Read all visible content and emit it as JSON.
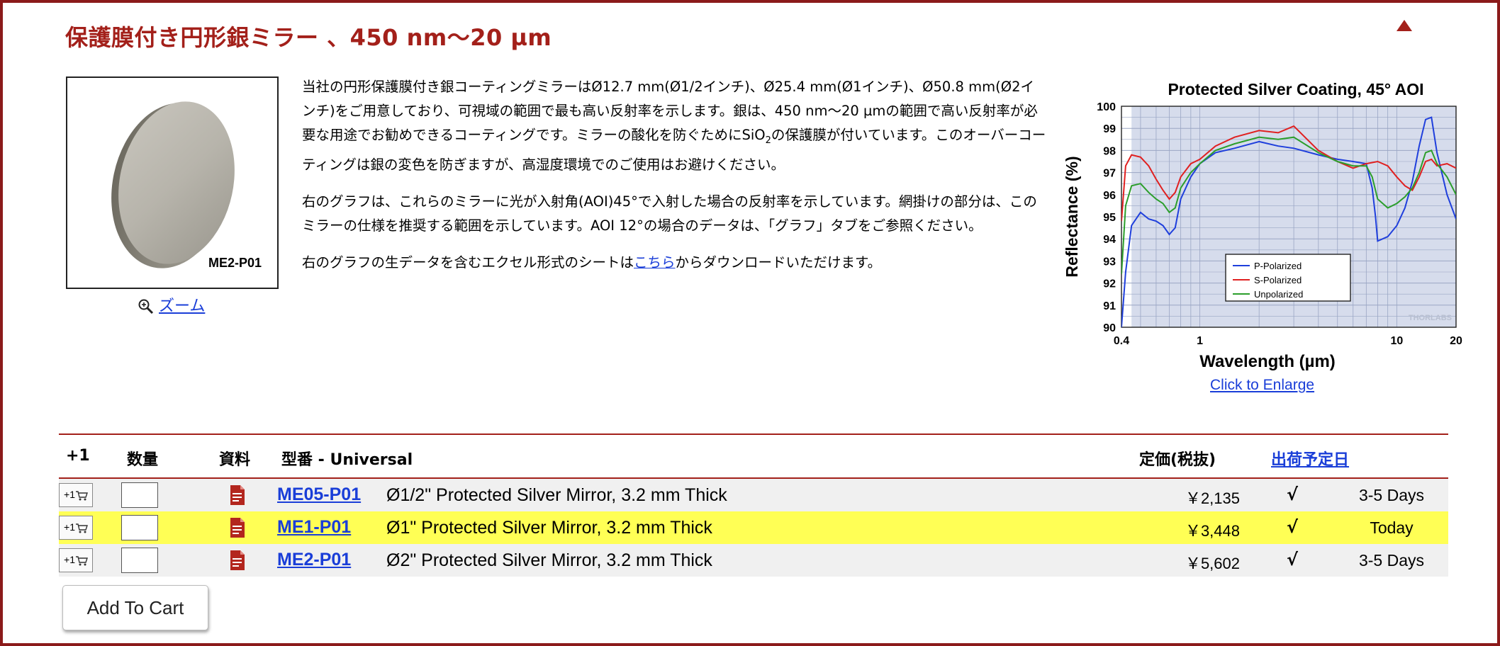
{
  "title": "保護膜付き円形銀ミラー 、450 nm～20 µm",
  "image": {
    "label": "ME2-P01",
    "zoom_label": "ズーム"
  },
  "description": {
    "p1_a": "当社の円形保護膜付き銀コーティングミラーはØ12.7 mm(Ø1/2インチ)、Ø25.4 mm(Ø1インチ)、Ø50.8 mm(Ø2インチ)をご用意しており、可視域の範囲で最も高い反射率を示します。銀は、450 nm～20 µmの範囲で高い反射率が必要な用途でお勧めできるコーティングです。ミラーの酸化を防ぐためにSiO",
    "p1_sub": "2",
    "p1_b": "の保護膜が付いています。このオーバーコーティングは銀の変色を防ぎますが、高湿度環境でのご使用はお避けください。",
    "p2": "右のグラフは、これらのミラーに光が入射角(AOI)45°で入射した場合の反射率を示しています。網掛けの部分は、このミラーの仕様を推奨する範囲を示しています。AOI 12°の場合のデータは、「グラフ」タブをご参照ください。",
    "p3_a": "右のグラフの生データを含むエクセル形式のシートは",
    "p3_link": "こちら",
    "p3_b": "からダウンロードいただけます。"
  },
  "enlarge_label": "Click to Enlarge",
  "chart_data": {
    "type": "line",
    "title": "Protected Silver Coating, 45° AOI",
    "xlabel": "Wavelength (µm)",
    "ylabel": "Reflectance (%)",
    "x_scale": "log",
    "xlim": [
      0.4,
      20
    ],
    "ylim": [
      90,
      100
    ],
    "x_ticks": [
      "0.4",
      "1",
      "10",
      "20"
    ],
    "y_ticks": [
      "90",
      "91",
      "92",
      "93",
      "94",
      "95",
      "96",
      "97",
      "98",
      "99",
      "100"
    ],
    "grid": true,
    "shaded_range": [
      0.45,
      20
    ],
    "legend_position": "bottom-center",
    "watermark": "THORLABS",
    "series": [
      {
        "name": "P-Polarized",
        "color": "#1f3fdc",
        "x": [
          0.4,
          0.42,
          0.45,
          0.5,
          0.55,
          0.6,
          0.65,
          0.7,
          0.75,
          0.8,
          0.9,
          1.0,
          1.2,
          1.5,
          2,
          2.5,
          3,
          4,
          5,
          6,
          7,
          7.5,
          7.8,
          8,
          9,
          10,
          11,
          12,
          13,
          14,
          15,
          16,
          18,
          20
        ],
        "y": [
          90,
          92.5,
          94.6,
          95.2,
          94.9,
          94.8,
          94.6,
          94.2,
          94.5,
          95.8,
          96.8,
          97.4,
          97.9,
          98.1,
          98.4,
          98.2,
          98.1,
          97.8,
          97.6,
          97.5,
          97.4,
          96.3,
          95.0,
          93.9,
          94.1,
          94.6,
          95.4,
          96.6,
          98.2,
          99.4,
          99.5,
          97.9,
          96.0,
          94.9
        ]
      },
      {
        "name": "S-Polarized",
        "color": "#e02020",
        "x": [
          0.4,
          0.42,
          0.45,
          0.5,
          0.55,
          0.6,
          0.65,
          0.7,
          0.75,
          0.8,
          0.9,
          1.0,
          1.2,
          1.5,
          2,
          2.5,
          3,
          4,
          5,
          6,
          7,
          8,
          9,
          10,
          11,
          12,
          13,
          14,
          15,
          16,
          18,
          20
        ],
        "y": [
          94.8,
          97.3,
          97.8,
          97.7,
          97.3,
          96.7,
          96.2,
          95.8,
          96.1,
          96.8,
          97.4,
          97.6,
          98.2,
          98.6,
          98.9,
          98.8,
          99.1,
          98.0,
          97.5,
          97.2,
          97.4,
          97.5,
          97.3,
          96.8,
          96.4,
          96.2,
          96.8,
          97.5,
          97.6,
          97.3,
          97.4,
          97.2
        ]
      },
      {
        "name": "Unpolarized",
        "color": "#2b9e2b",
        "x": [
          0.4,
          0.42,
          0.45,
          0.5,
          0.55,
          0.6,
          0.65,
          0.7,
          0.75,
          0.8,
          0.9,
          1.0,
          1.2,
          1.5,
          2,
          2.5,
          3,
          4,
          5,
          6,
          7,
          7.5,
          8,
          9,
          10,
          11,
          12,
          13,
          14,
          15,
          16,
          18,
          20
        ],
        "y": [
          92.4,
          95.5,
          96.4,
          96.5,
          96.1,
          95.8,
          95.6,
          95.2,
          95.4,
          96.3,
          97.0,
          97.4,
          98.0,
          98.3,
          98.6,
          98.5,
          98.6,
          97.9,
          97.5,
          97.3,
          97.3,
          96.8,
          95.8,
          95.4,
          95.6,
          95.9,
          96.3,
          97.0,
          97.9,
          98.0,
          97.4,
          96.8,
          96.0
        ]
      }
    ]
  },
  "table": {
    "headers": {
      "plus1": "+1",
      "qty": "数量",
      "docs": "資料",
      "part": "型番 - Universal",
      "price": "定価(税抜)",
      "ship": "出荷予定日"
    },
    "rows": [
      {
        "part": "ME05-P01",
        "desc": "Ø1/2\" Protected Silver Mirror, 3.2 mm Thick",
        "price": "￥2,135",
        "check": "√",
        "ship": "3-5 Days"
      },
      {
        "part": "ME1-P01",
        "desc": "Ø1\" Protected Silver Mirror, 3.2 mm Thick",
        "price": "￥3,448",
        "check": "√",
        "ship": "Today"
      },
      {
        "part": "ME2-P01",
        "desc": "Ø2\" Protected Silver Mirror, 3.2 mm Thick",
        "price": "￥5,602",
        "check": "√",
        "ship": "3-5 Days"
      }
    ],
    "cart_icon_label": "+1",
    "add_to_cart": "Add To Cart"
  }
}
